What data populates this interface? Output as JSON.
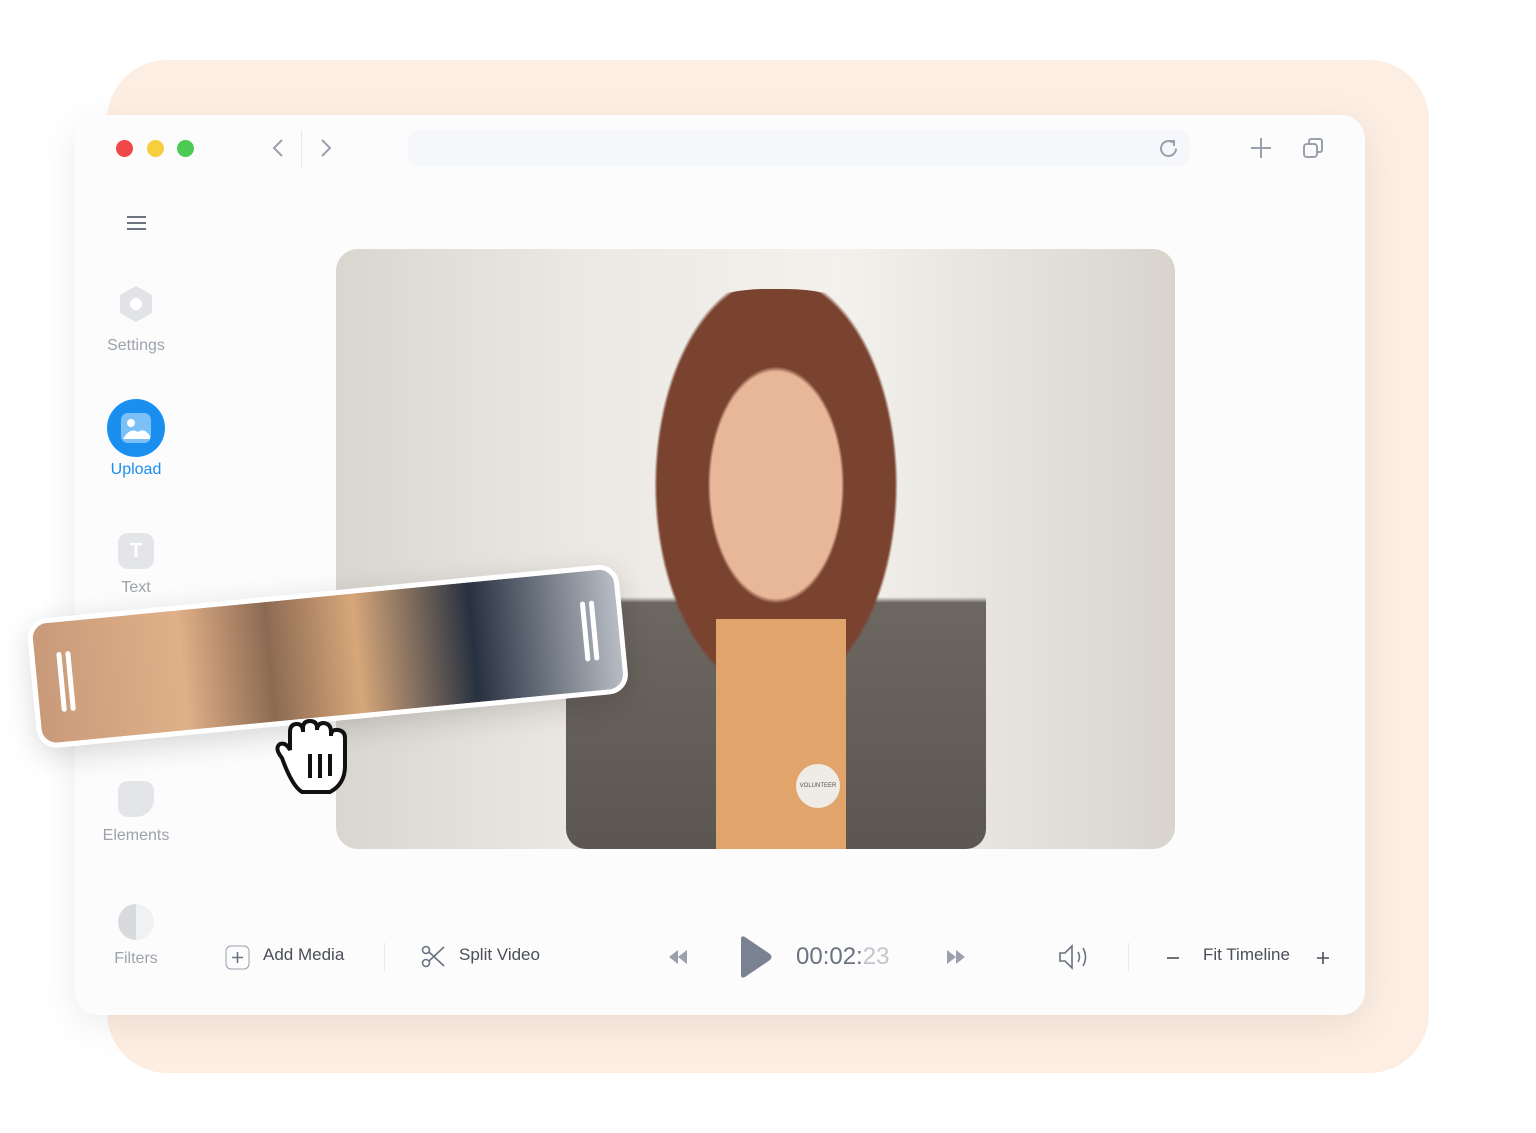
{
  "sidebar": {
    "items": [
      {
        "label": "Settings",
        "icon": "settings-icon"
      },
      {
        "label": "Upload",
        "icon": "image-icon",
        "active": true
      },
      {
        "label": "Text",
        "icon": "text-icon"
      },
      {
        "label": "Elements",
        "icon": "sticker-icon"
      },
      {
        "label": "Filters",
        "icon": "contrast-icon"
      }
    ]
  },
  "video": {
    "badge_text": "VOLUNTEER"
  },
  "toolbar": {
    "add_media": "Add Media",
    "split_video": "Split Video",
    "time_main": "00:02:",
    "time_frames": "23",
    "fit_timeline": "Fit Timeline"
  },
  "colors": {
    "accent": "#1a8ff0",
    "background": "#fdeee3",
    "traffic_red": "#f04848",
    "traffic_yellow": "#f6cf3f",
    "traffic_green": "#4ccb52"
  }
}
